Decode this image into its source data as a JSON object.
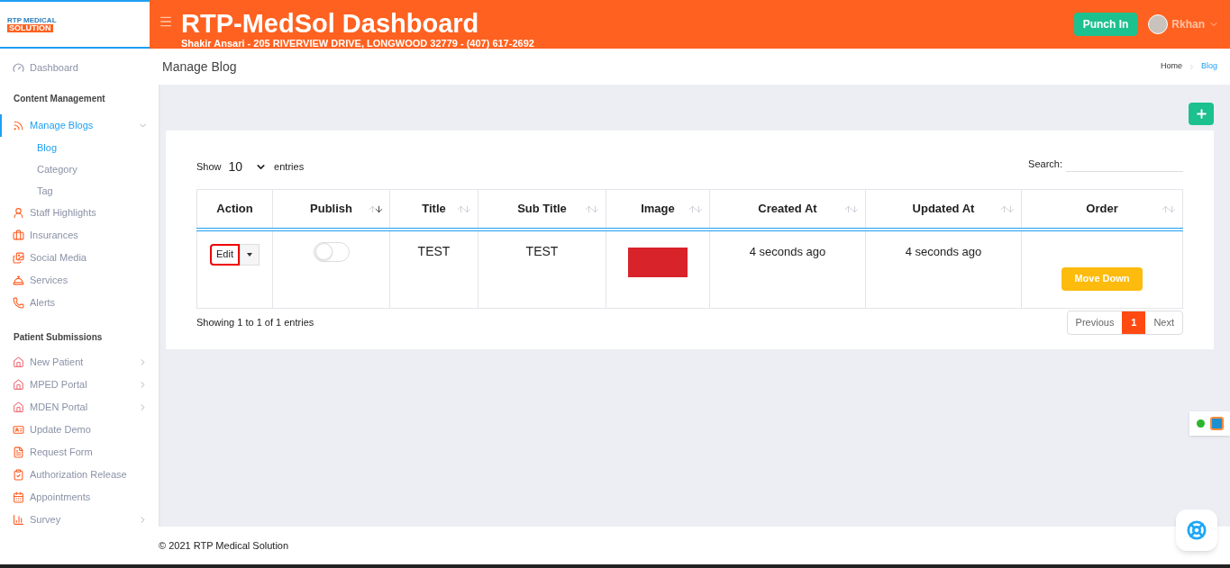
{
  "logo": {
    "line1": "RTP MEDICAL",
    "line2": "SOLUTION"
  },
  "header": {
    "title": "RTP-MedSol Dashboard",
    "subtitle": "Shakir Ansari - 205 RIVERVIEW DRIVE, LONGWOOD 32779 - (407) 617-2692",
    "punch_button": "Punch In",
    "user": "Rkhan"
  },
  "sidebar": {
    "sections": [
      {
        "items": [
          {
            "label": "Dashboard",
            "selected": false
          }
        ]
      },
      {
        "heading": "Content Management",
        "items": [
          {
            "label": "Manage Blogs",
            "selected": true,
            "expanded": true,
            "children": [
              {
                "label": "Blog",
                "selected": true
              },
              {
                "label": "Category",
                "selected": false
              },
              {
                "label": "Tag",
                "selected": false
              }
            ]
          },
          {
            "label": "Staff Highlights",
            "selected": false
          },
          {
            "label": "Insurances",
            "selected": false
          },
          {
            "label": "Social Media",
            "selected": false
          },
          {
            "label": "Services",
            "selected": false
          },
          {
            "label": "Alerts",
            "selected": false
          }
        ]
      },
      {
        "heading": "Patient Submissions",
        "items": [
          {
            "label": "New Patient",
            "selected": false,
            "expanded": false
          },
          {
            "label": "MPED Portal",
            "selected": false,
            "expanded": false
          },
          {
            "label": "MDEN Portal",
            "selected": false,
            "expanded": false
          },
          {
            "label": "Update Demo",
            "selected": false
          },
          {
            "label": "Request Form",
            "selected": false
          },
          {
            "label": "Authorization Release",
            "selected": false
          },
          {
            "label": "Appointments",
            "selected": false
          },
          {
            "label": "Survey",
            "selected": false,
            "expanded": false
          }
        ]
      }
    ]
  },
  "page": {
    "title": "Manage Blog",
    "breadcrumb": [
      {
        "label": "Home",
        "selected": false
      },
      {
        "label": "Blog",
        "selected": true
      }
    ]
  },
  "table_controls": {
    "show_label": "Show",
    "page_size": "10",
    "entries_label": "entries",
    "search_label": "Search:"
  },
  "table": {
    "columns": [
      {
        "label": "Action"
      },
      {
        "label": "Publish",
        "sorted": true
      },
      {
        "label": "Title",
        "sorted": false
      },
      {
        "label": "Sub Title",
        "sorted": false
      },
      {
        "label": "Image",
        "sorted": false
      },
      {
        "label": "Created At",
        "sorted": false
      },
      {
        "label": "Updated At",
        "sorted": false
      },
      {
        "label": "Order",
        "sorted": false
      }
    ],
    "rows": [
      {
        "action": "Edit",
        "action_focused": true,
        "publish_on": false,
        "title": "TEST",
        "sub_title": "TEST",
        "created_at": "4 seconds ago",
        "updated_at": "4 seconds ago",
        "order_button": "Move Down"
      }
    ]
  },
  "table_info": "Showing 1 to 1 of 1 entries",
  "pagination": {
    "previous": "Previous",
    "pages": [
      {
        "label": "1",
        "selected": true
      }
    ],
    "next": "Next"
  },
  "footer": "© 2021 RTP Medical Solution"
}
